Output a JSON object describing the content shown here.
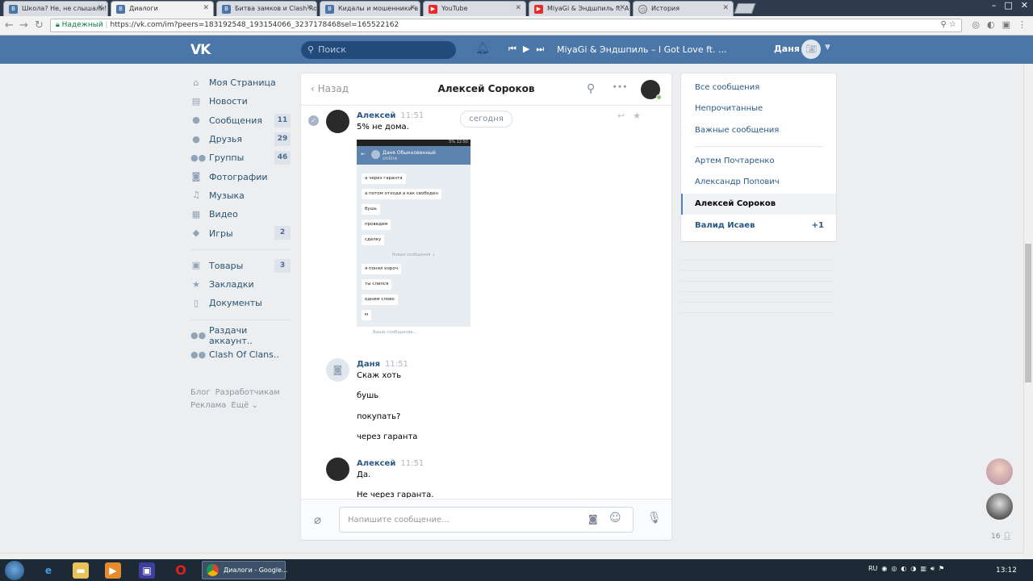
{
  "browser": {
    "tabs": [
      {
        "title": "Школа? Не, не слышали!"
      },
      {
        "title": "Диалоги"
      },
      {
        "title": "Битва замков и Clash Roy"
      },
      {
        "title": "Кидалы и мошенники в"
      },
      {
        "title": "YouTube"
      },
      {
        "title": "MiyaGi & Эндшпиль ft. An"
      },
      {
        "title": "История"
      }
    ],
    "secure_label": "Надежный",
    "url": "https://vk.com/im?peers=183192548_193154066_3237178468sel=165522162"
  },
  "header": {
    "logo": "VK",
    "search_placeholder": "Поиск",
    "now_playing": "MiyaGi & Эндшпиль – I Got Love ft. ...",
    "user_name": "Даня"
  },
  "left_menu": {
    "items": [
      {
        "label": "Моя Страница",
        "badge": ""
      },
      {
        "label": "Новости",
        "badge": ""
      },
      {
        "label": "Сообщения",
        "badge": "11"
      },
      {
        "label": "Друзья",
        "badge": "29"
      },
      {
        "label": "Группы",
        "badge": "46"
      },
      {
        "label": "Фотографии",
        "badge": ""
      },
      {
        "label": "Музыка",
        "badge": ""
      },
      {
        "label": "Видео",
        "badge": ""
      },
      {
        "label": "Игры",
        "badge": "2"
      }
    ],
    "items2": [
      {
        "label": "Товары",
        "badge": "3"
      },
      {
        "label": "Закладки",
        "badge": ""
      },
      {
        "label": "Документы",
        "badge": ""
      }
    ],
    "items3": [
      {
        "label": "Раздачи аккаунт.."
      },
      {
        "label": "Clash Of Clans.."
      }
    ],
    "footer": [
      "Блог",
      "Разработчикам",
      "Реклама",
      "Ещё ⌄"
    ]
  },
  "chat": {
    "back_label": "Назад",
    "title": "Алексей Сороков",
    "today_label": "сегодня",
    "messages": [
      {
        "author": "Алексей",
        "time": "11:51",
        "lines": [
          "5% не дома."
        ]
      },
      {
        "author": "Даня",
        "time": "11:51",
        "lines": [
          "Скаж хоть",
          "бушь",
          "покупать?",
          "через гаранта"
        ]
      },
      {
        "author": "Алексей",
        "time": "11:51",
        "lines": [
          "Да.",
          "Не через гаранта."
        ]
      }
    ],
    "photo": {
      "status": "5% 12:50",
      "header_name": "Даня Обыкновенный",
      "header_sub": "online",
      "bubbles": [
        "а через гаранта",
        "а потом отходи а как свободен",
        "бушь",
        "проведем",
        "сделку",
        "я понял короч",
        "ты слился",
        "одним слово",
        "м"
      ],
      "new_messages_label": "Новые сообщения ↓",
      "input_placeholder": "Ваше сообщение..."
    },
    "composer_placeholder": "Напишите сообщение..."
  },
  "right_panel": {
    "filters": [
      "Все сообщения",
      "Непрочитанные",
      "Важные сообщения"
    ],
    "conversations": [
      {
        "name": "Артем Почтаренко",
        "count": ""
      },
      {
        "name": "Александр Попович",
        "count": ""
      },
      {
        "name": "Алексей Сороков",
        "count": ""
      },
      {
        "name": "Валид Исаев",
        "count": "+1"
      }
    ]
  },
  "friends_dock": {
    "online_count": "16"
  },
  "taskbar": {
    "active_task": "Диалоги - Google...",
    "language": "RU",
    "clock": "13:12"
  },
  "colors": {
    "vk_blue": "#4a76a8",
    "link": "#2a5885",
    "background": "#edeef0"
  }
}
